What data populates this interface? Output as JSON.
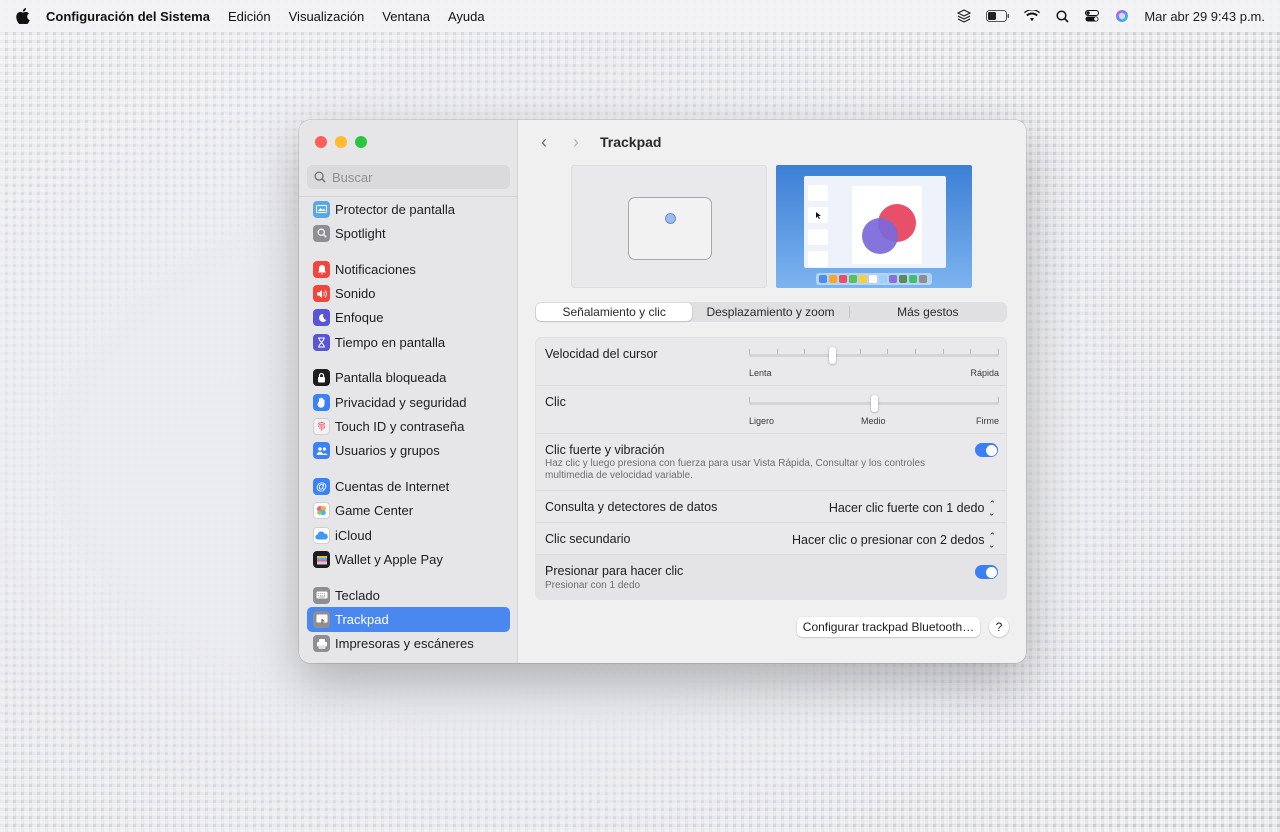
{
  "menubar": {
    "app_name": "Configuración del Sistema",
    "menus": [
      "Edición",
      "Visualización",
      "Ventana",
      "Ayuda"
    ],
    "clock": "Mar abr 29  9:43 p.m."
  },
  "sidebar": {
    "search_placeholder": "Buscar",
    "items": [
      {
        "label": "Protector de pantalla",
        "icon": "screensaver-icon",
        "color": "#5aa9e6"
      },
      {
        "label": "Spotlight",
        "icon": "spotlight-icon",
        "color": "#8e8e93"
      },
      {
        "label": "Notificaciones",
        "icon": "notifications-icon",
        "color": "#f0463c"
      },
      {
        "label": "Sonido",
        "icon": "sound-icon",
        "color": "#f0463c"
      },
      {
        "label": "Enfoque",
        "icon": "focus-icon",
        "color": "#5856d6"
      },
      {
        "label": "Tiempo en pantalla",
        "icon": "screen-time-icon",
        "color": "#5856d6"
      },
      {
        "label": "Pantalla bloqueada",
        "icon": "lock-screen-icon",
        "color": "#1d1d1f"
      },
      {
        "label": "Privacidad y seguridad",
        "icon": "privacy-hand-icon",
        "color": "#3b82f6"
      },
      {
        "label": "Touch ID y contraseña",
        "icon": "fingerprint-icon",
        "color": "#f2f2f4"
      },
      {
        "label": "Usuarios y grupos",
        "icon": "users-icon",
        "color": "#3b82f6"
      },
      {
        "label": "Cuentas de Internet",
        "icon": "at-sign-icon",
        "color": "#3b82f6"
      },
      {
        "label": "Game Center",
        "icon": "game-center-icon",
        "color": "#ffffff"
      },
      {
        "label": "iCloud",
        "icon": "icloud-icon",
        "color": "#ffffff"
      },
      {
        "label": "Wallet y Apple Pay",
        "icon": "wallet-icon",
        "color": "#1d1d1f"
      },
      {
        "label": "Teclado",
        "icon": "keyboard-icon",
        "color": "#8e8e93"
      },
      {
        "label": "Trackpad",
        "icon": "trackpad-icon",
        "color": "#8e8e93"
      },
      {
        "label": "Impresoras y escáneres",
        "icon": "printer-icon",
        "color": "#8e8e93"
      }
    ],
    "selected": "Trackpad"
  },
  "main": {
    "title": "Trackpad",
    "tabs": [
      "Señalamiento y clic",
      "Desplazamiento y zoom",
      "Más gestos"
    ],
    "active_tab": "Señalamiento y clic",
    "settings": {
      "cursor_speed": {
        "label": "Velocidad del cursor",
        "min_label": "Lenta",
        "max_label": "Rápida",
        "value_fraction": 0.33
      },
      "click": {
        "label": "Clic",
        "min_label": "Ligero",
        "mid_label": "Medio",
        "max_label": "Firme",
        "value": "Medio"
      },
      "force_click": {
        "label": "Clic fuerte y vibración",
        "description": "Haz clic y luego presiona con fuerza para usar Vista Rápida, Consultar y los controles multimedia de velocidad variable.",
        "enabled": true
      },
      "lookup": {
        "label": "Consulta y detectores de datos",
        "value": "Hacer clic fuerte con 1 dedo"
      },
      "secondary_click": {
        "label": "Clic secundario",
        "value": "Hacer clic o presionar con 2 dedos"
      },
      "tap_to_click": {
        "label": "Presionar para hacer clic",
        "description": "Presionar con 1 dedo",
        "enabled": true
      }
    },
    "bluetooth_button": "Configurar trackpad Bluetooth…",
    "help_button": "?"
  },
  "colors": {
    "accent": "#3b7ff5",
    "selection": "#4a87ee",
    "close": "#ff5f57",
    "minimize": "#febc2e",
    "zoom": "#28c840"
  }
}
